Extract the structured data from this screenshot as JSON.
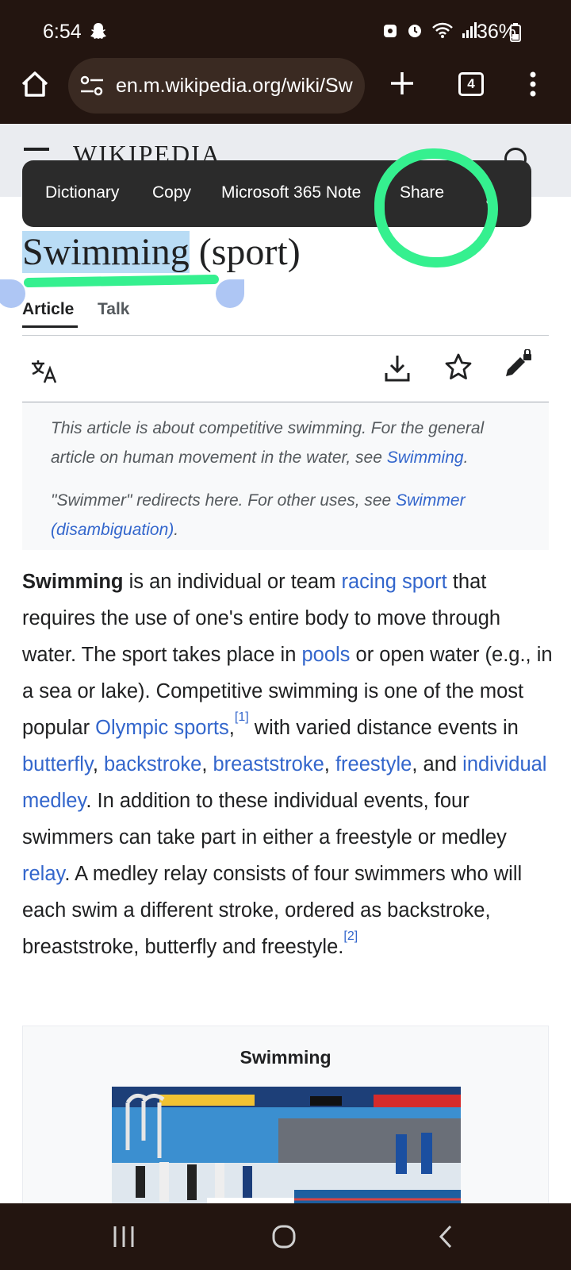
{
  "status": {
    "time": "6:54",
    "battery": "36%"
  },
  "browser": {
    "url": "en.m.wikipedia.org/wiki/Sw",
    "tab_count": "4"
  },
  "wiki_header": {
    "logo": "WIKIPEDIA"
  },
  "context_menu": {
    "items": [
      "Dictionary",
      "Copy",
      "Microsoft 365 Note",
      "Share"
    ]
  },
  "page": {
    "title_selected": "Swimming",
    "title_rest": " (sport)",
    "tabs": [
      "Article",
      "Talk"
    ]
  },
  "hatnote": {
    "p1_text": "This article is about competitive swimming. For the general article on human movement in the water, see ",
    "p1_link": "Swimming",
    "p1_end": ".",
    "p2_text": "\"Swimmer\" redirects here. For other uses, see ",
    "p2_link": "Swimmer (disambiguation)",
    "p2_end": "."
  },
  "intro": {
    "bold": "Swimming",
    "t1": " is an individual or team ",
    "l1": "racing sport",
    "t2": " that requires the use of one's entire body to move through water. The sport takes place in ",
    "l2": "pools",
    "t3": " or open water (e.g., in a sea or lake). Competitive swimming is one of the most popular ",
    "l3": "Olympic sports",
    "s1": "[1]",
    "t4": " with varied distance events in ",
    "l4": "butterfly",
    "t5": ", ",
    "l5": "backstroke",
    "t6": ", ",
    "l6": "breaststroke",
    "t7": ", ",
    "l7": "freestyle",
    "t8": ", and ",
    "l8": "individual medley",
    "t9": ". In addition to these individual events, four swimmers can take part in either a freestyle or medley ",
    "l9": "relay",
    "t10": ". A medley relay consists of four swimmers who will each swim a different stroke, ordered as backstroke, breaststroke, butterfly and freestyle.",
    "s2": "[2]"
  },
  "infobox": {
    "caption": "Swimming"
  },
  "colors": {
    "highlight": "#35f08f",
    "link": "#3366cc",
    "browser_bar": "#231510"
  }
}
